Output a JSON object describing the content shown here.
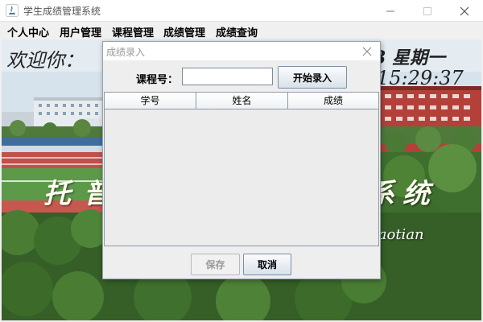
{
  "window": {
    "title": "学生成绩管理系统"
  },
  "menu": {
    "items": [
      "个人中心",
      "用户管理",
      "课程管理",
      "成绩管理",
      "成绩查询"
    ]
  },
  "background": {
    "welcome": "欢迎你：",
    "date_partial": "3 星期一",
    "time_partial": "15:29:37",
    "title_left_partial": "托普",
    "title_right_partial": "系统",
    "subtitle_partial": "iaotian"
  },
  "dialog": {
    "title": "成绩录入",
    "course_label": "课程号：",
    "course_input_value": "",
    "start_button": "开始录入",
    "table": {
      "columns": [
        "学号",
        "姓名",
        "成绩"
      ],
      "rows": []
    },
    "save_button": "保存",
    "cancel_button": "取消"
  }
}
